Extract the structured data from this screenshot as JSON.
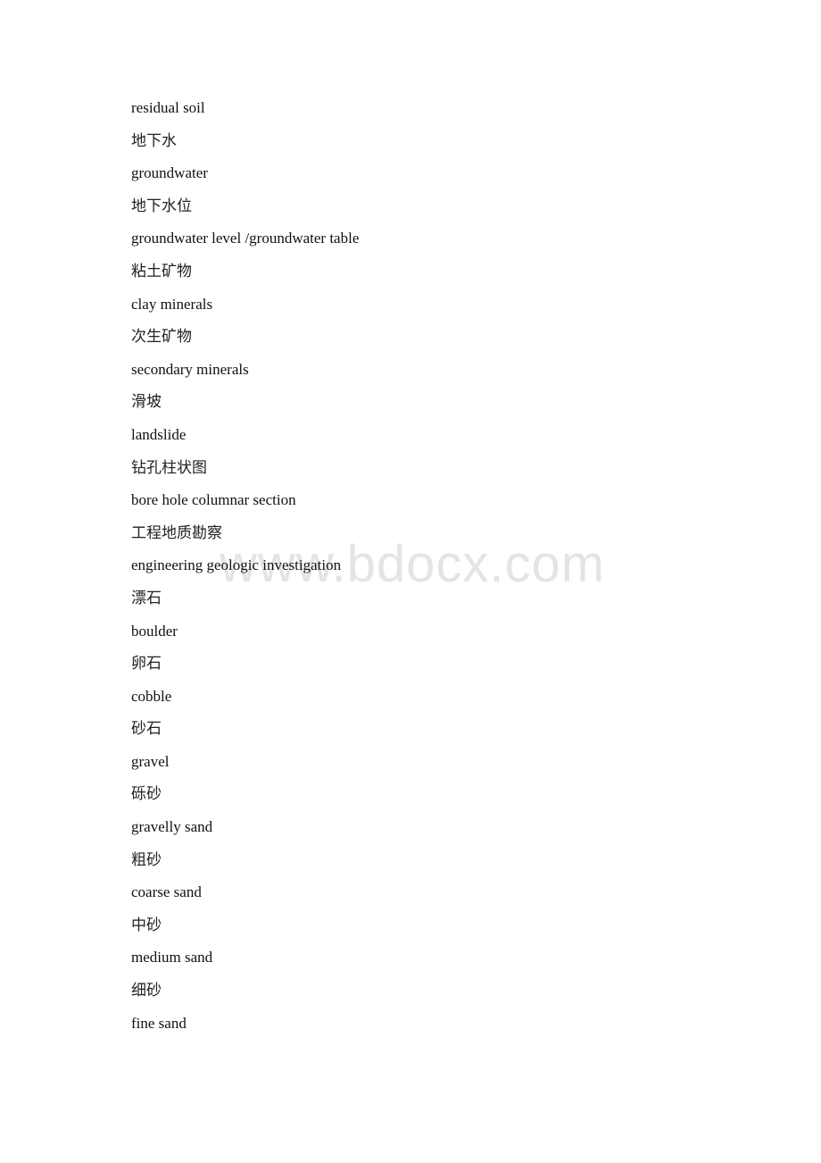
{
  "document": {
    "watermark": "www.bdocx.com",
    "entries": [
      {
        "lang": "en",
        "text": "residual soil"
      },
      {
        "lang": "zh",
        "text": "地下水"
      },
      {
        "lang": "en",
        "text": "groundwater"
      },
      {
        "lang": "zh",
        "text": "地下水位"
      },
      {
        "lang": "en",
        "text": "groundwater level /groundwater table"
      },
      {
        "lang": "zh",
        "text": "粘土矿物"
      },
      {
        "lang": "en",
        "text": "clay minerals"
      },
      {
        "lang": "zh",
        "text": "次生矿物"
      },
      {
        "lang": "en",
        "text": "secondary minerals"
      },
      {
        "lang": "zh",
        "text": "滑坡"
      },
      {
        "lang": "en",
        "text": "landslide"
      },
      {
        "lang": "zh",
        "text": "钻孔柱状图"
      },
      {
        "lang": "en",
        "text": "bore hole columnar section"
      },
      {
        "lang": "zh",
        "text": "工程地质勘察"
      },
      {
        "lang": "en",
        "text": "engineering geologic investigation"
      },
      {
        "lang": "zh",
        "text": "漂石"
      },
      {
        "lang": "en",
        "text": "boulder"
      },
      {
        "lang": "zh",
        "text": "卵石"
      },
      {
        "lang": "en",
        "text": "cobble"
      },
      {
        "lang": "zh",
        "text": "砂石"
      },
      {
        "lang": "en",
        "text": "gravel"
      },
      {
        "lang": "zh",
        "text": "砾砂"
      },
      {
        "lang": "en",
        "text": "gravelly sand"
      },
      {
        "lang": "zh",
        "text": "粗砂"
      },
      {
        "lang": "en",
        "text": "coarse sand"
      },
      {
        "lang": "zh",
        "text": "中砂"
      },
      {
        "lang": "en",
        "text": "medium sand"
      },
      {
        "lang": "zh",
        "text": "细砂"
      },
      {
        "lang": "en",
        "text": "fine sand"
      }
    ]
  }
}
